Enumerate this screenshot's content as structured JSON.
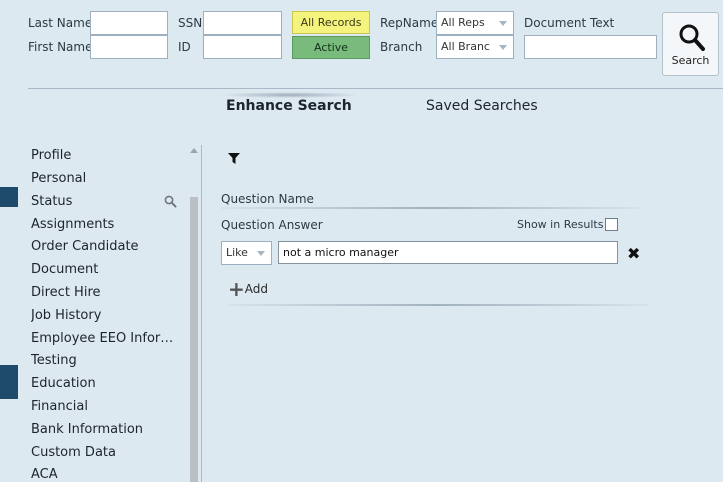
{
  "filters": {
    "last_name_label": "Last Name",
    "first_name_label": "First Name",
    "ssn_label": "SSN",
    "id_label": "ID",
    "last_name_value": "",
    "first_name_value": "",
    "ssn_value": "",
    "id_value": "",
    "all_records_label": "All Records",
    "active_label": "Active",
    "repname_label": "RepName",
    "branch_label": "Branch",
    "repname_selected": "All Reps",
    "branch_selected": "All Branc",
    "document_text_label": "Document Text",
    "document_text_value": "",
    "search_button_label": "Search"
  },
  "tabs": [
    {
      "label": "Enhance Search",
      "active": true
    },
    {
      "label": "Saved Searches",
      "active": false
    }
  ],
  "sidebar": {
    "items": [
      {
        "label": "Profile"
      },
      {
        "label": "Personal"
      },
      {
        "label": "Status"
      },
      {
        "label": "Assignments"
      },
      {
        "label": "Order Candidate"
      },
      {
        "label": "Document"
      },
      {
        "label": "Direct Hire"
      },
      {
        "label": "Job History"
      },
      {
        "label": "Employee EEO Infor…"
      },
      {
        "label": "Testing"
      },
      {
        "label": "Education"
      },
      {
        "label": "Financial"
      },
      {
        "label": "Bank Information"
      },
      {
        "label": "Custom Data"
      },
      {
        "label": "ACA"
      }
    ]
  },
  "criteria": {
    "question_name_label": "Question Name",
    "question_answer_label": "Question Answer",
    "show_in_results_label": "Show in Results",
    "show_in_results_checked": false,
    "operator_selected": "Like",
    "answer_value": "not a micro manager",
    "add_label": "Add"
  },
  "colors": {
    "background": "#dde9f1",
    "all_records_bg": "#f4f37e",
    "active_bg": "#79bb7c",
    "nav_marker": "#1e4b6c"
  }
}
